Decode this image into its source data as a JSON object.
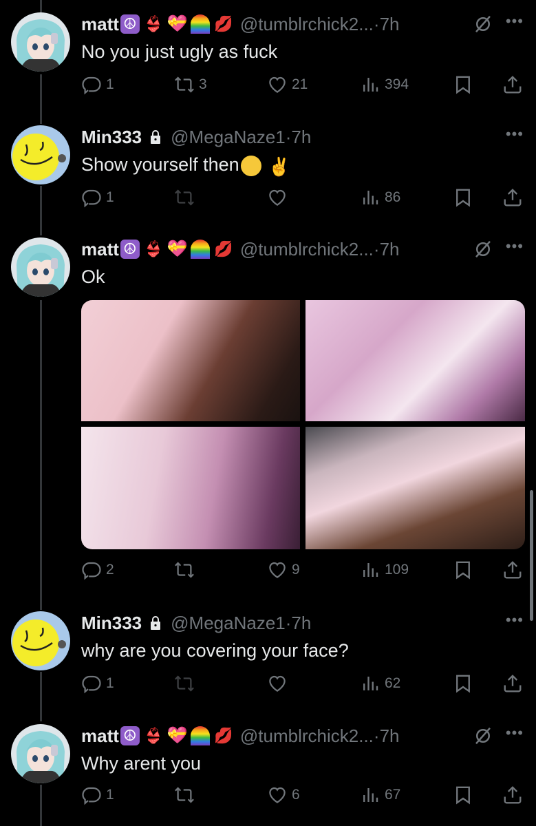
{
  "tweets": [
    {
      "name": "matt",
      "handle": "@tumblrchick2...",
      "time": "·7h",
      "text": "No you just ugly as fuck",
      "replies": "1",
      "reposts": "3",
      "likes": "21",
      "views": "394"
    },
    {
      "name": "Min333",
      "handle": "@MegaNaze1",
      "time": "·7h",
      "text": "Show yourself then",
      "replies": "1",
      "reposts": "",
      "likes": "",
      "views": "86"
    },
    {
      "name": "matt",
      "handle": "@tumblrchick2...",
      "time": "·7h",
      "text": "Ok",
      "replies": "2",
      "reposts": "",
      "likes": "9",
      "views": "109"
    },
    {
      "name": "Min333",
      "handle": "@MegaNaze1",
      "time": "·7h",
      "text": "why are you covering your face?",
      "replies": "1",
      "reposts": "",
      "likes": "",
      "views": "62"
    },
    {
      "name": "matt",
      "handle": "@tumblrchick2...",
      "time": "·7h",
      "text": "Why arent you",
      "replies": "1",
      "reposts": "",
      "likes": "6",
      "views": "67"
    }
  ],
  "icons": {
    "name_emojis": [
      "peace-symbol-emoji",
      "bikini-emoji",
      "heart-with-ribbon-emoji",
      "rainbow-emoji",
      "kiss-mark-emoji"
    ],
    "reply_emojis": [
      "loudly-crying-face-emoji",
      "victory-hand-emoji"
    ]
  },
  "colors": {
    "background": "#000000",
    "text": "#e7e9ea",
    "muted": "#71767b",
    "thread_line": "#333639"
  }
}
